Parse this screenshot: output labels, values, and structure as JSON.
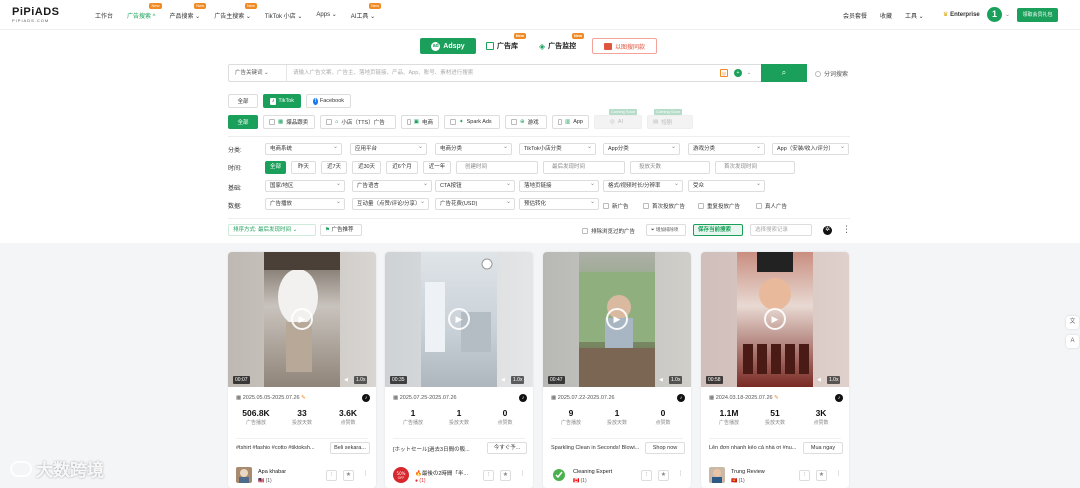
{
  "brand": {
    "name": "PiPiADS",
    "sub": "PIPIADS.COM"
  },
  "nav": [
    {
      "label": "工作台",
      "new": false
    },
    {
      "label": "广告搜索 ^",
      "new": true,
      "active": true
    },
    {
      "label": "产品搜索 ⌄",
      "new": true
    },
    {
      "label": "广告主搜索 ⌄",
      "new": true
    },
    {
      "label": "TikTok 小店 ⌄",
      "new": false
    },
    {
      "label": "Apps ⌄",
      "new": false
    },
    {
      "label": "AI工具 ⌄",
      "new": true
    }
  ],
  "right_nav": {
    "plan": "会员套餐",
    "fav": "收藏",
    "tools": "工具 ⌄",
    "enterprise": "Enterprise",
    "level": "1",
    "gift": "领取会员礼包"
  },
  "modes": {
    "adspy": "Adspy",
    "library": "广告库",
    "library_badge": "New",
    "monitor": "广告监控",
    "monitor_badge": "New",
    "image_search": "以图搜同款"
  },
  "search": {
    "type": "广告关键词",
    "placeholder": "请输入广告文案、广告主、落地页链接、产品、App、账号、素材进行搜索",
    "split": "分词搜索"
  },
  "platforms": [
    "全部",
    "TikTok",
    "Facebook"
  ],
  "types": [
    {
      "label": "全部",
      "state": "on"
    },
    {
      "label": "爆品跟卖",
      "state": "normal"
    },
    {
      "label": "小店（TTS）广告",
      "state": "normal"
    },
    {
      "label": "电商",
      "state": "normal"
    },
    {
      "label": "Spark Ads",
      "state": "normal"
    },
    {
      "label": "游戏",
      "state": "normal"
    },
    {
      "label": "App",
      "state": "normal"
    },
    {
      "label": "AI",
      "state": "dis",
      "badge": "Coming Soon"
    },
    {
      "label": "短剧",
      "state": "dis",
      "badge": "Coming Soon"
    }
  ],
  "filters": {
    "category_label": "分类:",
    "category": [
      "电商系统",
      "应用平台",
      "电商分类",
      "TikTok小店分类",
      "App分类",
      "游戏分类",
      "App（安装/收入/评分）"
    ],
    "time_label": "时间:",
    "time": [
      "全部",
      "昨天",
      "近7天",
      "近30天",
      "近6个月",
      "近一年"
    ],
    "time_inputs": [
      "创建时间",
      "最后发现时间",
      "投放天数",
      "首次发现时间"
    ],
    "basic_label": "基础:",
    "basic": [
      "国家/地区",
      "广告语言",
      "CTA按钮",
      "落地页链接",
      "格式/视频时长/分辨率",
      "受众"
    ],
    "data_label": "数据:",
    "data": [
      "广告播放",
      "互动量（点赞/评论/分享）",
      "广告花费(USD)",
      "预估转化"
    ],
    "checks": [
      "新广告",
      "首次投放广告",
      "重复投放广告",
      "真人广告"
    ]
  },
  "sortbar": {
    "sort": "排序方式: 最后发现时间 ⌄",
    "recommend": "广告推荐",
    "exclude": "排除浏览过的广告",
    "add_exclude": "增加排除项",
    "save": "保存当前搜索",
    "records": "选择搜索记录"
  },
  "cards": [
    {
      "duration": "00:07",
      "speed": "1.0x",
      "date": "2025.05.05-2025.07.26",
      "plays": "506.8K",
      "days": "33",
      "likes": "3.6K",
      "caption": "#tshirt #fashio #cotto #tiktoksh...",
      "cta": "Beli sekara...",
      "adv": "Apa khabar",
      "flag": "🇲🇾 (1)"
    },
    {
      "duration": "00:35",
      "speed": "1.0x",
      "date": "2025.07.25-2025.07.26",
      "plays": "1",
      "days": "1",
      "likes": "0",
      "caption": "[ホットセール]過去3日間の販...",
      "cta": "今すぐ予...",
      "adv": "🔥最後の2時間「半...",
      "flag": "● (1)"
    },
    {
      "duration": "00:47",
      "speed": "1.0x",
      "date": "2025.07.22-2025.07.26",
      "plays": "9",
      "days": "1",
      "likes": "0",
      "caption": "Sparkling Clean in Seconds! Blowi...",
      "cta": "Shop now",
      "adv": "Cleaning Expert",
      "flag": "🇨🇦 (1)"
    },
    {
      "duration": "00:58",
      "speed": "1.0x",
      "date": "2024.03.18-2025.07.26",
      "plays": "1.1M",
      "days": "51",
      "likes": "3K",
      "caption": "Lên đơn nhanh kẻo cả nhà ơi #nu...",
      "cta": "Mua ngay",
      "adv": "Trung Review",
      "flag": "🇻🇳 (1)"
    }
  ],
  "stat_labels": {
    "plays": "广告播放",
    "days": "投放天数",
    "likes": "点赞数"
  },
  "watermark": "大数跨境",
  "colors": {
    "accent": "#1aa05a",
    "badge": "#f08a24"
  }
}
